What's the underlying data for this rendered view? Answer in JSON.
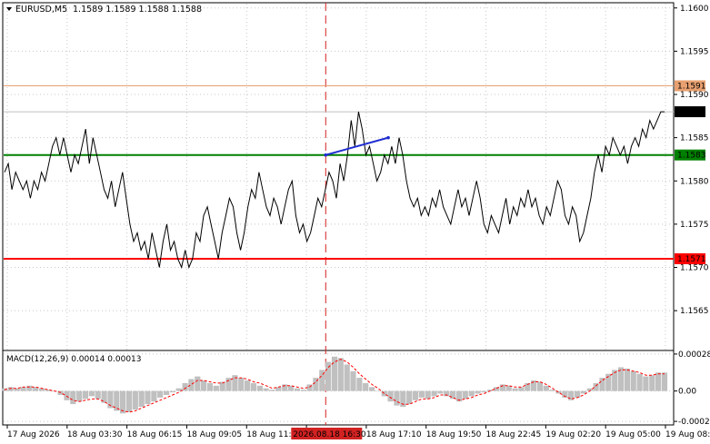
{
  "header": {
    "menu_icon": "triangle-down-icon",
    "symbol": "EURUSD,M5",
    "ohlc": "1.1589 1.1589 1.1588 1.1588"
  },
  "colors": {
    "price_line": "#000000",
    "resistance": "#e8a070",
    "level_green": "#008000",
    "support": "#ff0000",
    "trendline": "#1f2dd0",
    "session_marker": "#d22222",
    "macd_hist": "#c0c0c0",
    "macd_signal": "#ff0000",
    "current_price_tag": "#000000",
    "tag_text": "#ffffff"
  },
  "chart_data": {
    "type": "line",
    "title": "EURUSD,M5",
    "price_axis": {
      "ylim": [
        1.15605,
        1.16005
      ],
      "ticks": [
        "1.1600",
        "1.1595",
        "1.1590",
        "1.1585",
        "1.1580",
        "1.1575",
        "1.1570",
        "1.1565"
      ]
    },
    "time_axis": {
      "labels": [
        "17 Aug 2026",
        "18 Aug 03:30",
        "18 Aug 06:15",
        "18 Aug 09:05",
        "18 Aug 11:45",
        "18 Aug 14:35",
        "18 Aug 17:10",
        "18 Aug 19:50",
        "18 Aug 22:45",
        "19 Aug 02:20",
        "19 Aug 05:00",
        "19 Aug 08:00"
      ],
      "highlight_label": "2026.08.18 16:30"
    },
    "levels": [
      {
        "label": "1.1591",
        "value": 1.1591,
        "color": "#e8a070"
      },
      {
        "label": "1.1583",
        "value": 1.1583,
        "color": "#008000"
      },
      {
        "label": "1.1571",
        "value": 1.1571,
        "color": "#ff0000"
      }
    ],
    "current_price": {
      "label": "1.1588",
      "value": 1.1588
    },
    "grid": true,
    "session_marker_index": 0.484,
    "trendline": {
      "x": [
        0.484,
        0.578
      ],
      "y": [
        1.1583,
        1.1585
      ]
    },
    "series": [
      {
        "values": [
          1.1581,
          1.1582,
          1.1579,
          1.1581,
          1.158,
          1.1579,
          1.158,
          1.1578,
          1.158,
          1.1579,
          1.1581,
          1.158,
          1.1582,
          1.1584,
          1.1585,
          1.1583,
          1.1585,
          1.1583,
          1.1581,
          1.1583,
          1.1582,
          1.1584,
          1.1586,
          1.1582,
          1.1585,
          1.1583,
          1.1581,
          1.1579,
          1.1578,
          1.158,
          1.1577,
          1.1579,
          1.1581,
          1.1578,
          1.1575,
          1.1573,
          1.1574,
          1.1572,
          1.1573,
          1.1571,
          1.1574,
          1.1572,
          1.157,
          1.1573,
          1.1575,
          1.1572,
          1.1573,
          1.1571,
          1.157,
          1.1572,
          1.157,
          1.1571,
          1.1574,
          1.1573,
          1.1576,
          1.1577,
          1.1575,
          1.1573,
          1.1571,
          1.1574,
          1.1576,
          1.1578,
          1.1577,
          1.1574,
          1.1572,
          1.1574,
          1.1577,
          1.1579,
          1.1578,
          1.1581,
          1.1579,
          1.1577,
          1.1576,
          1.1578,
          1.1577,
          1.1575,
          1.1577,
          1.1579,
          1.158,
          1.1576,
          1.1574,
          1.1575,
          1.1573,
          1.1574,
          1.1576,
          1.1578,
          1.1577,
          1.1579,
          1.1581,
          1.158,
          1.1578,
          1.1582,
          1.158,
          1.1583,
          1.1587,
          1.1584,
          1.1588,
          1.1586,
          1.1583,
          1.1584,
          1.1582,
          1.158,
          1.1581,
          1.1583,
          1.1582,
          1.1584,
          1.1582,
          1.1585,
          1.1583,
          1.158,
          1.1578,
          1.1577,
          1.1578,
          1.1576,
          1.1577,
          1.1576,
          1.1578,
          1.1577,
          1.1579,
          1.1577,
          1.1576,
          1.1575,
          1.1577,
          1.1579,
          1.1577,
          1.1578,
          1.1576,
          1.1578,
          1.158,
          1.1578,
          1.1575,
          1.1574,
          1.1576,
          1.1575,
          1.1574,
          1.1576,
          1.1578,
          1.1575,
          1.1577,
          1.1576,
          1.1578,
          1.1577,
          1.1579,
          1.1577,
          1.1578,
          1.1576,
          1.1575,
          1.1577,
          1.1576,
          1.1578,
          1.158,
          1.1579,
          1.1576,
          1.1575,
          1.1577,
          1.1576,
          1.1573,
          1.1574,
          1.1576,
          1.1578,
          1.1581,
          1.1583,
          1.1581,
          1.1584,
          1.1583,
          1.1585,
          1.1584,
          1.1583,
          1.1584,
          1.1582,
          1.1584,
          1.1585,
          1.1584,
          1.1586,
          1.1585,
          1.1587,
          1.1586,
          1.1587,
          1.1588,
          1.1588
        ]
      }
    ],
    "macd": {
      "label": "MACD(12,26,9) 0.00014 0.00013",
      "ylim": [
        -0.00025,
        0.0003
      ],
      "ticks": [
        "0.00028",
        "0.00",
        "-0.00023"
      ],
      "histogram": [
        2e-05,
        3e-05,
        2e-05,
        3e-05,
        4e-05,
        3e-05,
        2e-05,
        1e-05,
        0.0,
        -3e-05,
        -7e-05,
        -0.0001,
        -8e-05,
        -6e-05,
        -4e-05,
        -6e-05,
        -9e-05,
        -0.00013,
        -0.00015,
        -0.00017,
        -0.00016,
        -0.00014,
        -0.00012,
        -0.0001,
        -8e-05,
        -5e-05,
        -3e-05,
        -1e-05,
        2e-05,
        6e-05,
        9e-05,
        0.00011,
        8e-05,
        6e-05,
        4e-05,
        7e-05,
        0.0001,
        0.00012,
        0.0001,
        8e-05,
        6e-05,
        4e-05,
        2e-05,
        1e-05,
        3e-05,
        5e-05,
        4e-05,
        2e-05,
        1e-05,
        5e-05,
        0.0001,
        0.00016,
        0.00022,
        0.00026,
        0.00025,
        0.0002,
        0.00015,
        0.0001,
        6e-05,
        3e-05,
        0.0,
        -4e-05,
        -8e-05,
        -0.00011,
        -0.00012,
        -0.0001,
        -7e-05,
        -5e-05,
        -6e-05,
        -4e-05,
        -2e-05,
        -4e-05,
        -6e-05,
        -8e-05,
        -6e-05,
        -4e-05,
        -2e-05,
        -1e-05,
        1e-05,
        3e-05,
        5e-05,
        4e-05,
        2e-05,
        3e-05,
        6e-05,
        8e-05,
        7e-05,
        4e-05,
        1e-05,
        -2e-05,
        -5e-05,
        -7e-05,
        -5e-05,
        -2e-05,
        2e-05,
        6e-05,
        0.0001,
        0.00013,
        0.00016,
        0.00018,
        0.00017,
        0.00015,
        0.00013,
        0.00011,
        0.00012,
        0.00014,
        0.00014
      ],
      "signal": [
        1e-05,
        2e-05,
        2e-05,
        3e-05,
        3e-05,
        3e-05,
        2e-05,
        1e-05,
        0.0,
        -1e-05,
        -4e-05,
        -7e-05,
        -8e-05,
        -7e-05,
        -6e-05,
        -6e-05,
        -8e-05,
        -0.00011,
        -0.00013,
        -0.00015,
        -0.00016,
        -0.00015,
        -0.00013,
        -0.00011,
        -9e-05,
        -7e-05,
        -5e-05,
        -3e-05,
        -1e-05,
        2e-05,
        5e-05,
        8e-05,
        8e-05,
        7e-05,
        6e-05,
        6e-05,
        8e-05,
        0.0001,
        0.0001,
        9e-05,
        7e-05,
        6e-05,
        4e-05,
        2e-05,
        3e-05,
        4e-05,
        4e-05,
        3e-05,
        2e-05,
        3e-05,
        7e-05,
        0.00012,
        0.00018,
        0.00022,
        0.00024,
        0.00022,
        0.00018,
        0.00013,
        9e-05,
        5e-05,
        2e-05,
        -2e-05,
        -5e-05,
        -8e-05,
        -0.0001,
        -0.0001,
        -8e-05,
        -6e-05,
        -6e-05,
        -5e-05,
        -3e-05,
        -3e-05,
        -5e-05,
        -7e-05,
        -6e-05,
        -5e-05,
        -3e-05,
        -2e-05,
        0.0,
        2e-05,
        4e-05,
        4e-05,
        3e-05,
        3e-05,
        5e-05,
        7e-05,
        7e-05,
        5e-05,
        2e-05,
        -1e-05,
        -4e-05,
        -6e-05,
        -5e-05,
        -3e-05,
        0.0,
        4e-05,
        8e-05,
        0.00011,
        0.00014,
        0.00016,
        0.00016,
        0.00015,
        0.00014,
        0.00012,
        0.00012,
        0.00013,
        0.00013
      ]
    }
  }
}
